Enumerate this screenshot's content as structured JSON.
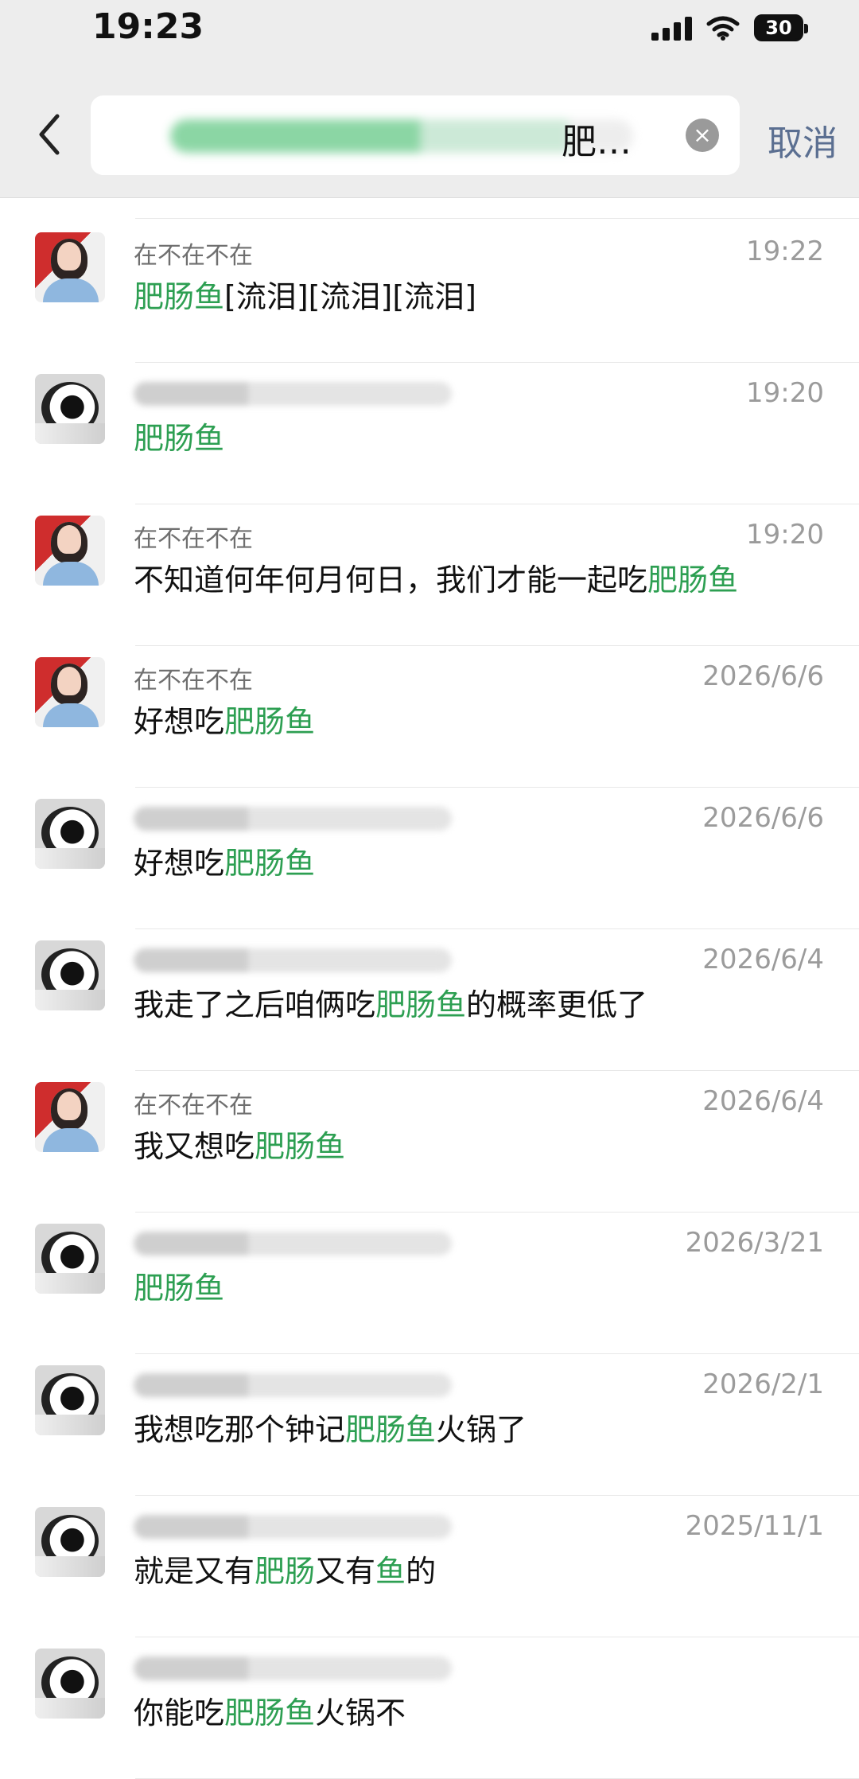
{
  "status": {
    "time": "19:23",
    "battery": "30"
  },
  "search": {
    "query_visible": "肥…",
    "cancel": "取消"
  },
  "results": [
    {
      "sender": "在不在不在",
      "time": "19:22",
      "avatar": "girl",
      "blurred": false,
      "segments": [
        {
          "text": "肥肠鱼",
          "hl": true
        },
        {
          "text": "[流泪][流泪][流泪]",
          "hl": false
        }
      ]
    },
    {
      "sender": "",
      "time": "19:20",
      "avatar": "dog",
      "blurred": true,
      "segments": [
        {
          "text": "肥肠鱼",
          "hl": true
        }
      ]
    },
    {
      "sender": "在不在不在",
      "time": "19:20",
      "avatar": "girl",
      "blurred": false,
      "segments": [
        {
          "text": "不知道何年何月何日，我们才能一起吃",
          "hl": false
        },
        {
          "text": "肥肠鱼",
          "hl": true
        }
      ]
    },
    {
      "sender": "在不在不在",
      "time": "2026/6/6",
      "avatar": "girl",
      "blurred": false,
      "segments": [
        {
          "text": "好想吃",
          "hl": false
        },
        {
          "text": "肥肠鱼",
          "hl": true
        }
      ]
    },
    {
      "sender": "",
      "time": "2026/6/6",
      "avatar": "dog",
      "blurred": true,
      "segments": [
        {
          "text": "好想吃",
          "hl": false
        },
        {
          "text": "肥肠鱼",
          "hl": true
        }
      ]
    },
    {
      "sender": "",
      "time": "2026/6/4",
      "avatar": "dog",
      "blurred": true,
      "segments": [
        {
          "text": "我走了之后咱俩吃",
          "hl": false
        },
        {
          "text": "肥肠鱼",
          "hl": true
        },
        {
          "text": "的概率更低了",
          "hl": false
        }
      ]
    },
    {
      "sender": "在不在不在",
      "time": "2026/6/4",
      "avatar": "girl",
      "blurred": false,
      "segments": [
        {
          "text": "我又想吃",
          "hl": false
        },
        {
          "text": "肥肠鱼",
          "hl": true
        }
      ]
    },
    {
      "sender": "",
      "time": "2026/3/21",
      "avatar": "dog",
      "blurred": true,
      "segments": [
        {
          "text": "肥肠鱼",
          "hl": true
        }
      ]
    },
    {
      "sender": "",
      "time": "2026/2/1",
      "avatar": "dog",
      "blurred": true,
      "segments": [
        {
          "text": "我想吃那个钟记",
          "hl": false
        },
        {
          "text": "肥肠鱼",
          "hl": true
        },
        {
          "text": "火锅了",
          "hl": false
        }
      ]
    },
    {
      "sender": "",
      "time": "2025/11/1",
      "avatar": "dog",
      "blurred": true,
      "segments": [
        {
          "text": "就是又有",
          "hl": false
        },
        {
          "text": "肥肠",
          "hl": true
        },
        {
          "text": "又有",
          "hl": false
        },
        {
          "text": "鱼",
          "hl": true
        },
        {
          "text": "的",
          "hl": false
        }
      ]
    },
    {
      "sender": "",
      "time": "",
      "avatar": "dog",
      "blurred": true,
      "segments": [
        {
          "text": "你能吃",
          "hl": false
        },
        {
          "text": "肥肠鱼",
          "hl": true
        },
        {
          "text": "火锅不",
          "hl": false
        }
      ]
    }
  ]
}
